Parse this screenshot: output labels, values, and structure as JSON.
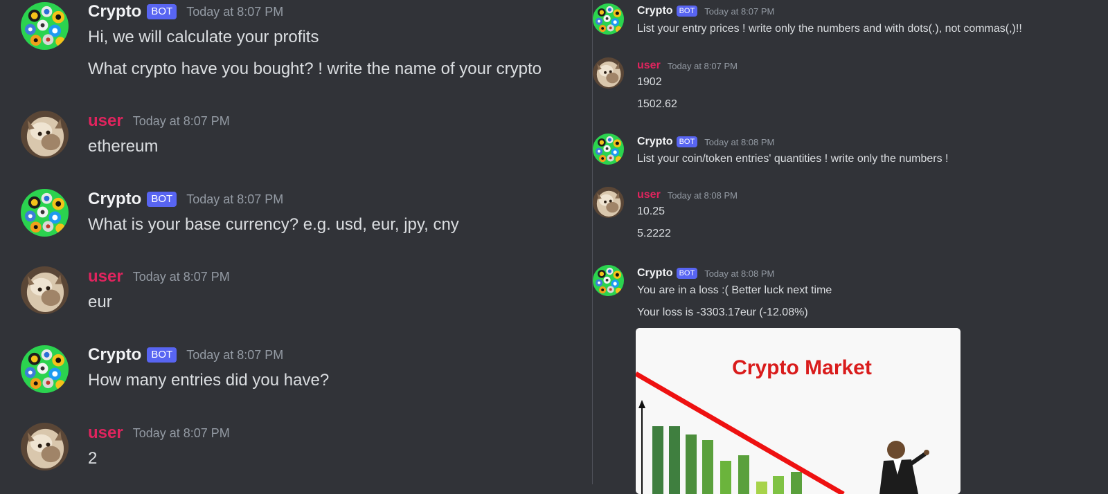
{
  "left": {
    "messages": [
      {
        "author": "Crypto",
        "bot": true,
        "badge": "BOT",
        "time": "Today at 8:07 PM",
        "lines": [
          "Hi, we will calculate your profits",
          "What crypto have you bought?   ! write the name of your crypto"
        ]
      },
      {
        "author": "user",
        "bot": false,
        "time": "Today at 8:07 PM",
        "lines": [
          "ethereum"
        ]
      },
      {
        "author": "Crypto",
        "bot": true,
        "badge": "BOT",
        "time": "Today at 8:07 PM",
        "lines": [
          "What is your base currency? e.g. usd, eur, jpy, cny"
        ]
      },
      {
        "author": "user",
        "bot": false,
        "time": "Today at 8:07 PM",
        "lines": [
          "eur"
        ]
      },
      {
        "author": "Crypto",
        "bot": true,
        "badge": "BOT",
        "time": "Today at 8:07 PM",
        "lines": [
          "How many entries did you have?"
        ]
      },
      {
        "author": "user",
        "bot": false,
        "time": "Today at 8:07 PM",
        "lines": [
          "2"
        ]
      }
    ]
  },
  "right": {
    "messages": [
      {
        "author": "Crypto",
        "bot": true,
        "badge": "BOT",
        "time": "Today at 8:07 PM",
        "lines": [
          "List your entry prices  ! write only the numbers and with dots(.), not commas(,)!!"
        ]
      },
      {
        "author": "user",
        "bot": false,
        "time": "Today at 8:07 PM",
        "lines": [
          "1902",
          "1502.62"
        ]
      },
      {
        "author": "Crypto",
        "bot": true,
        "badge": "BOT",
        "time": "Today at 8:08 PM",
        "lines": [
          "List your coin/token entries' quantities  ! write only the numbers !"
        ]
      },
      {
        "author": "user",
        "bot": false,
        "time": "Today at 8:08 PM",
        "lines": [
          "10.25",
          "5.2222"
        ]
      },
      {
        "author": "Crypto",
        "bot": true,
        "badge": "BOT",
        "time": "Today at 8:08 PM",
        "lines": [
          "You are in a loss  :(  Better luck next time",
          "Your loss is -3303.17eur (-12.08%)"
        ]
      }
    ],
    "embed": {
      "caption": "Crypto Market"
    }
  },
  "colors": {
    "background": "#313338",
    "user_name": "#e0245e",
    "bot_badge": "#5865f2",
    "timestamp": "#949ba4",
    "message_text": "#dbdee1"
  },
  "icons": {
    "bot_avatar": "crypto-coins-avatar-icon",
    "user_avatar": "cat-avatar-icon"
  }
}
